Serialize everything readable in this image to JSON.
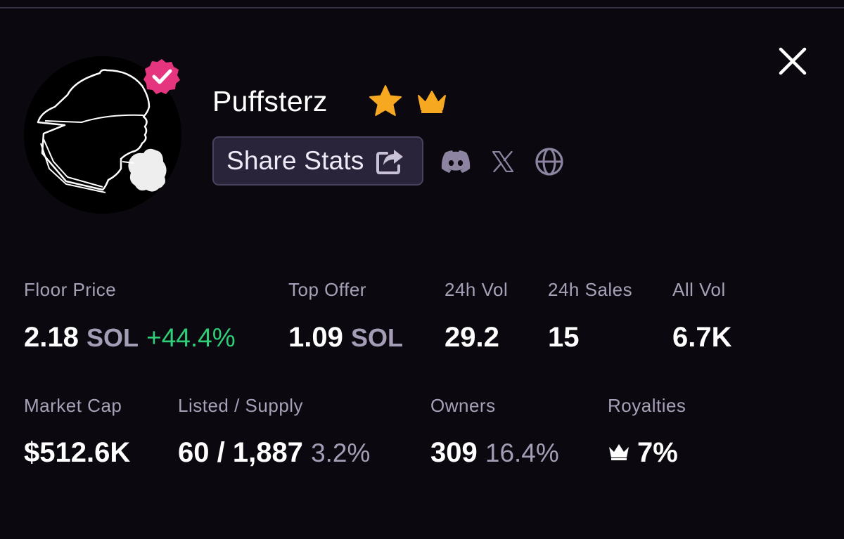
{
  "collection": {
    "name": "Puffsterz",
    "avatar_icon": "silhouette-smoking-avatar",
    "verified_icon": "verified-check-icon",
    "star_icon": "star-icon",
    "crown_icon": "crown-icon"
  },
  "actions": {
    "share_label": "Share Stats",
    "share_icon": "share-external-icon",
    "socials": [
      "discord-icon",
      "x-icon",
      "globe-icon"
    ],
    "close_icon": "close-icon"
  },
  "stats": {
    "floor_price": {
      "label": "Floor Price",
      "value": "2.18",
      "unit": "SOL",
      "change": "+44.4%"
    },
    "top_offer": {
      "label": "Top Offer",
      "value": "1.09",
      "unit": "SOL"
    },
    "vol_24h": {
      "label": "24h Vol",
      "value": "29.2"
    },
    "sales_24h": {
      "label": "24h Sales",
      "value": "15"
    },
    "all_vol": {
      "label": "All Vol",
      "value": "6.7K"
    },
    "market_cap": {
      "label": "Market Cap",
      "value": "$512.6K"
    },
    "listed_supply": {
      "label": "Listed / Supply",
      "value": "60 / 1,887",
      "pct": "3.2%"
    },
    "owners": {
      "label": "Owners",
      "value": "309",
      "pct": "16.4%"
    },
    "royalties": {
      "label": "Royalties",
      "value": "7%"
    }
  },
  "colors": {
    "background": "#0b090f",
    "accent_pink": "#e5357f",
    "gold": "#f6a821",
    "positive": "#2fcf78",
    "muted": "#a8a0b7",
    "button_bg": "#29243a"
  }
}
